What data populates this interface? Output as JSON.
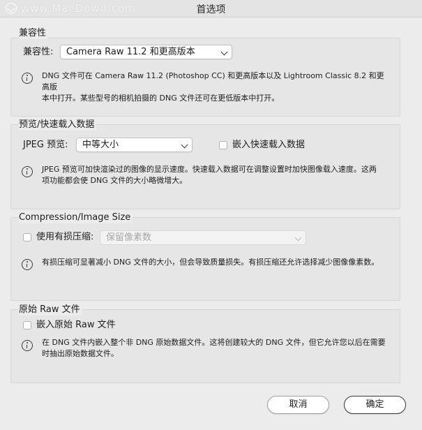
{
  "window": {
    "title": "首选项",
    "watermark": "www.MacDown.com"
  },
  "compatibility": {
    "title": "兼容性",
    "label": "兼容性:",
    "selected": "Camera Raw 11.2 和更高版本",
    "info_line1": "DNG 文件可在 Camera Raw 11.2 (Photoshop CC) 和更高版本以及 Lightroom Classic 8.2 和更高版",
    "info_line2": "本中打开。某些型号的相机拍摄的 DNG 文件还可在更低版本中打开。"
  },
  "preview": {
    "title": "预览/快速载入数据",
    "jpeg_label": "JPEG 预览:",
    "jpeg_selected": "中等大小",
    "embed_fast_load_label": "嵌入快速载入数据",
    "embed_fast_load_checked": false,
    "info_line1": "JPEG 预览可加快渲染过的图像的显示速度。快速载入数据可在调整设置时加快图像载入速度。这两",
    "info_line2": "项功能都会使 DNG 文件的大小略微增大。"
  },
  "compression": {
    "title": "Compression/Image Size",
    "lossy_label": "使用有损压缩:",
    "lossy_checked": false,
    "lossy_selected": "保留像素数",
    "info_line1": "有损压缩可显著减小 DNG 文件的大小，但会导致质量损失。有损压缩还允许选择减少图像像素数。"
  },
  "raw": {
    "title": "原始 Raw 文件",
    "embed_label": "嵌入原始 Raw 文件",
    "embed_checked": false,
    "info_line1": "在 DNG 文件内嵌入整个非 DNG 原始数据文件。这将创建较大的 DNG 文件，但它允许您以后在需要",
    "info_line2": "时抽出原始数据文件。"
  },
  "footer": {
    "cancel_label": "取消",
    "ok_label": "确定"
  },
  "colors": {
    "background": "#ececec",
    "group_background": "#e6e6e6",
    "border": "#d6d6d6"
  }
}
